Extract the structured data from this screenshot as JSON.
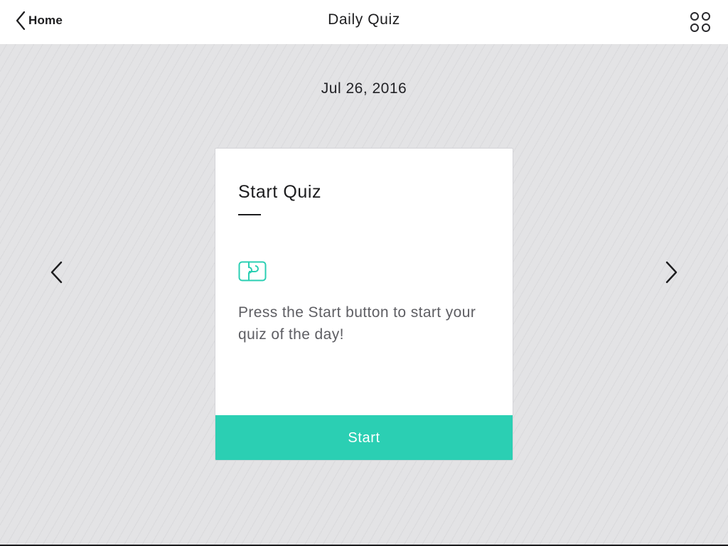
{
  "header": {
    "back_label": "Home",
    "back_icon": "chevron-left-icon",
    "title": "Daily Quiz",
    "apps_icon": "four-circles-grid-icon"
  },
  "main": {
    "date": "Jul 26, 2016",
    "prev_icon": "chevron-left-icon",
    "next_icon": "chevron-right-icon"
  },
  "card": {
    "title": "Start Quiz",
    "icon": "puzzle-piece-icon",
    "message": "Press the Start button to start your quiz of the day!",
    "button_label": "Start"
  },
  "colors": {
    "accent": "#2bcfb3",
    "background": "#e3e3e5",
    "text_dark": "#1d1d1f",
    "text_muted": "#5e5e63"
  }
}
